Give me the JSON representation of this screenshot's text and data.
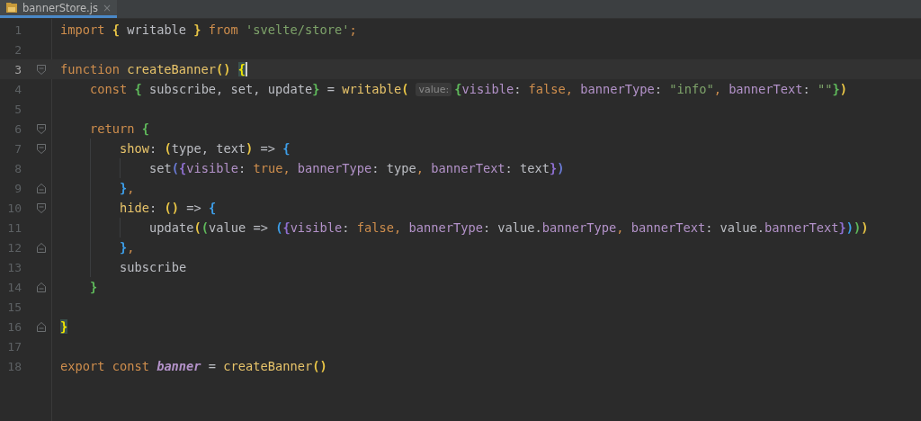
{
  "tab": {
    "name": "bannerStore.js",
    "close": "×",
    "selected": true
  },
  "lines": [
    {
      "number": "1",
      "current": false,
      "tokens": [
        {
          "text": "import ",
          "kind": "keyword"
        },
        {
          "text": "{",
          "kind": "bracket",
          "color": "#e8c546"
        },
        {
          "text": " writable ",
          "kind": "plain"
        },
        {
          "text": "}",
          "kind": "bracket",
          "color": "#e8c546"
        },
        {
          "text": " from ",
          "kind": "keyword"
        },
        {
          "text": "'svelte/store'",
          "kind": "string"
        },
        {
          "text": ";",
          "kind": "keyword"
        }
      ]
    },
    {
      "number": "2",
      "current": false
    },
    {
      "number": "3",
      "current": true,
      "kind": "fold-start",
      "tokens": [
        {
          "text": "function ",
          "kind": "keyword"
        },
        {
          "text": "createBanner",
          "kind": "function"
        },
        {
          "text": "() ",
          "kind": "bracket",
          "color": "#e8c546"
        },
        {
          "text": "{",
          "kind": "matched-bracket"
        }
      ],
      "children": [
        {
          "number": "4",
          "current": false,
          "tokens": [
            {
              "text": "const ",
              "kind": "keyword"
            },
            {
              "text": "{",
              "kind": "bracket",
              "color": "#5fb95b"
            },
            {
              "text": " subscribe, set, update",
              "kind": "plain"
            },
            {
              "text": "}",
              "kind": "bracket",
              "color": "#5fb95b"
            },
            {
              "text": " = ",
              "kind": "plain"
            },
            {
              "text": "writable",
              "kind": "function"
            },
            {
              "text": "(",
              "kind": "bracket",
              "color": "#e8c546"
            },
            {
              "text": "value:",
              "kind": "hint"
            },
            {
              "text": "{",
              "kind": "bracket",
              "color": "#5fb95b"
            },
            {
              "text": "visible",
              "kind": "property"
            },
            {
              "text": ": ",
              "kind": "plain"
            },
            {
              "text": "false",
              "kind": "keyword"
            },
            {
              "text": ", ",
              "kind": "keyword"
            },
            {
              "text": "bannerType",
              "kind": "property"
            },
            {
              "text": ": ",
              "kind": "plain"
            },
            {
              "text": "\"info\"",
              "kind": "string"
            },
            {
              "text": ", ",
              "kind": "keyword"
            },
            {
              "text": "bannerText",
              "kind": "property"
            },
            {
              "text": ": ",
              "kind": "plain"
            },
            {
              "text": "\"\"",
              "kind": "string"
            },
            {
              "text": "}",
              "kind": "bracket",
              "color": "#5fb95b"
            },
            {
              "text": ")",
              "kind": "bracket",
              "color": "#e8c546"
            }
          ]
        },
        {
          "number": "5",
          "current": false
        },
        {
          "number": "6",
          "current": false,
          "kind": "fold-start",
          "tokens": [
            {
              "text": "return ",
              "kind": "keyword"
            },
            {
              "text": "{",
              "kind": "bracket",
              "color": "#5fb95b"
            }
          ],
          "children": [
            {
              "number": "7",
              "current": false,
              "kind": "fold-start",
              "tokens": [
                {
                  "text": "show",
                  "kind": "function"
                },
                {
                  "text": ": ",
                  "kind": "plain"
                },
                {
                  "text": "(",
                  "kind": "bracket",
                  "color": "#e8c546"
                },
                {
                  "text": "type, text",
                  "kind": "plain"
                },
                {
                  "text": ")",
                  "kind": "bracket",
                  "color": "#e8c546"
                },
                {
                  "text": " => ",
                  "kind": "plain"
                },
                {
                  "text": "{",
                  "kind": "bracket",
                  "color": "#3d9ee8"
                }
              ],
              "children": [
                {
                  "number": "8",
                  "current": false,
                  "tokens": [
                    {
                      "text": "set",
                      "kind": "plain"
                    },
                    {
                      "text": "(",
                      "kind": "bracket",
                      "color": "#6a7bd6"
                    },
                    {
                      "text": "{",
                      "kind": "bracket",
                      "color": "#8f6fd0"
                    },
                    {
                      "text": "visible",
                      "kind": "property"
                    },
                    {
                      "text": ": ",
                      "kind": "plain"
                    },
                    {
                      "text": "true",
                      "kind": "keyword"
                    },
                    {
                      "text": ", ",
                      "kind": "keyword"
                    },
                    {
                      "text": "bannerType",
                      "kind": "property"
                    },
                    {
                      "text": ": type",
                      "kind": "plain"
                    },
                    {
                      "text": ", ",
                      "kind": "keyword"
                    },
                    {
                      "text": "bannerText",
                      "kind": "property"
                    },
                    {
                      "text": ": text",
                      "kind": "plain"
                    },
                    {
                      "text": "}",
                      "kind": "bracket",
                      "color": "#8f6fd0"
                    },
                    {
                      "text": ")",
                      "kind": "bracket",
                      "color": "#6a7bd6"
                    }
                  ]
                }
              ]
            },
            {
              "number": "9",
              "current": false,
              "kind": "fold-end",
              "tokens": [
                {
                  "text": "}",
                  "kind": "bracket",
                  "color": "#3d9ee8"
                },
                {
                  "text": ",",
                  "kind": "keyword"
                }
              ]
            },
            {
              "number": "10",
              "current": false,
              "kind": "fold-start",
              "tokens": [
                {
                  "text": "hide",
                  "kind": "function"
                },
                {
                  "text": ": ",
                  "kind": "plain"
                },
                {
                  "text": "()",
                  "kind": "bracket",
                  "color": "#e8c546"
                },
                {
                  "text": " => ",
                  "kind": "plain"
                },
                {
                  "text": "{",
                  "kind": "bracket",
                  "color": "#3d9ee8"
                }
              ],
              "children": [
                {
                  "number": "11",
                  "current": false,
                  "tokens": [
                    {
                      "text": "update",
                      "kind": "plain"
                    },
                    {
                      "text": "(",
                      "kind": "bracket",
                      "color": "#e8c546"
                    },
                    {
                      "text": "(",
                      "kind": "bracket",
                      "color": "#5fb95b"
                    },
                    {
                      "text": "value => ",
                      "kind": "plain"
                    },
                    {
                      "text": "(",
                      "kind": "bracket",
                      "color": "#3d9ee8"
                    },
                    {
                      "text": "{",
                      "kind": "bracket",
                      "color": "#8f6fd0"
                    },
                    {
                      "text": "visible",
                      "kind": "property"
                    },
                    {
                      "text": ": ",
                      "kind": "plain"
                    },
                    {
                      "text": "false",
                      "kind": "keyword"
                    },
                    {
                      "text": ", ",
                      "kind": "keyword"
                    },
                    {
                      "text": "bannerType",
                      "kind": "property"
                    },
                    {
                      "text": ": value.",
                      "kind": "plain"
                    },
                    {
                      "text": "bannerType",
                      "kind": "property"
                    },
                    {
                      "text": ", ",
                      "kind": "keyword"
                    },
                    {
                      "text": "bannerText",
                      "kind": "property"
                    },
                    {
                      "text": ": value.",
                      "kind": "plain"
                    },
                    {
                      "text": "bannerText",
                      "kind": "property"
                    },
                    {
                      "text": "}",
                      "kind": "bracket",
                      "color": "#8f6fd0"
                    },
                    {
                      "text": ")",
                      "kind": "bracket",
                      "color": "#3d9ee8"
                    },
                    {
                      "text": ")",
                      "kind": "bracket",
                      "color": "#5fb95b"
                    },
                    {
                      "text": ")",
                      "kind": "bracket",
                      "color": "#e8c546"
                    }
                  ]
                }
              ]
            },
            {
              "number": "12",
              "current": false,
              "kind": "fold-end",
              "tokens": [
                {
                  "text": "}",
                  "kind": "bracket",
                  "color": "#3d9ee8"
                },
                {
                  "text": ",",
                  "kind": "keyword"
                }
              ]
            },
            {
              "number": "13",
              "current": false,
              "tokens": [
                {
                  "text": "subscribe",
                  "kind": "plain"
                }
              ]
            }
          ]
        },
        {
          "number": "14",
          "current": false,
          "kind": "fold-end",
          "tokens": [
            {
              "text": "}",
              "kind": "bracket",
              "color": "#5fb95b"
            }
          ]
        },
        {
          "number": "15",
          "current": false
        }
      ]
    },
    {
      "number": "16",
      "current": false,
      "kind": "fold-end",
      "tokens": [
        {
          "text": "}",
          "kind": "matched-bracket"
        }
      ]
    },
    {
      "number": "17",
      "current": false
    },
    {
      "number": "18",
      "current": false,
      "tokens": [
        {
          "text": "export const ",
          "kind": "keyword"
        },
        {
          "text": "banner",
          "kind": "variable"
        },
        {
          "text": " = ",
          "kind": "plain"
        },
        {
          "text": "createBanner",
          "kind": "function"
        },
        {
          "text": "()",
          "kind": "bracket",
          "color": "#e8c546"
        }
      ]
    }
  ]
}
